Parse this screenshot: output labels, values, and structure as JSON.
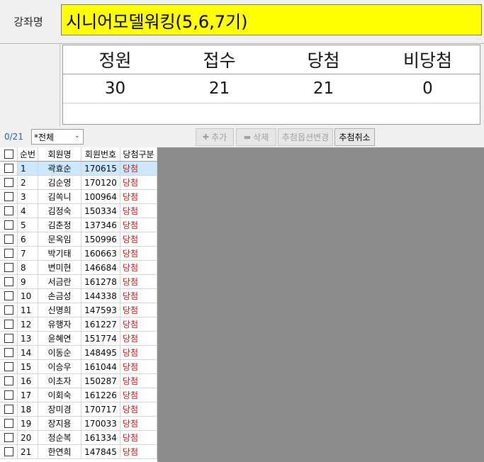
{
  "course": {
    "label": "강좌명",
    "name": "시니어모델워킹(5,6,7기)"
  },
  "stats": {
    "headers": [
      "정원",
      "접수",
      "당첨",
      "비당첨"
    ],
    "values": [
      "30",
      "21",
      "21",
      "0"
    ]
  },
  "toolbar": {
    "selected_count": "0/21",
    "filter_value": "*전체",
    "add_label": "추가",
    "delete_label": "삭제",
    "change_option_label": "추첨옵션변경",
    "cancel_draw_label": "추첨취소"
  },
  "grid": {
    "columns": [
      "순번",
      "회원명",
      "회원번호",
      "당첨구분"
    ],
    "rows": [
      {
        "no": "1",
        "name": "곽효순",
        "member_no": "170615",
        "status": "당첨"
      },
      {
        "no": "2",
        "name": "김순영",
        "member_no": "170120",
        "status": "당첨"
      },
      {
        "no": "3",
        "name": "김쏙니",
        "member_no": "100964",
        "status": "당첨"
      },
      {
        "no": "4",
        "name": "김정숙",
        "member_no": "150334",
        "status": "당첨"
      },
      {
        "no": "5",
        "name": "김춘정",
        "member_no": "137346",
        "status": "당첨"
      },
      {
        "no": "6",
        "name": "문옥임",
        "member_no": "150996",
        "status": "당첨"
      },
      {
        "no": "7",
        "name": "박기태",
        "member_no": "160663",
        "status": "당첨"
      },
      {
        "no": "8",
        "name": "변미현",
        "member_no": "146684",
        "status": "당첨"
      },
      {
        "no": "9",
        "name": "서금란",
        "member_no": "161278",
        "status": "당첨"
      },
      {
        "no": "10",
        "name": "손금성",
        "member_no": "144338",
        "status": "당첨"
      },
      {
        "no": "11",
        "name": "신명희",
        "member_no": "147593",
        "status": "당첨"
      },
      {
        "no": "12",
        "name": "유행자",
        "member_no": "161227",
        "status": "당첨"
      },
      {
        "no": "13",
        "name": "윤혜연",
        "member_no": "151774",
        "status": "당첨"
      },
      {
        "no": "14",
        "name": "이동순",
        "member_no": "148495",
        "status": "당첨"
      },
      {
        "no": "15",
        "name": "이승우",
        "member_no": "161044",
        "status": "당첨"
      },
      {
        "no": "16",
        "name": "이초자",
        "member_no": "150287",
        "status": "당첨"
      },
      {
        "no": "17",
        "name": "이회숙",
        "member_no": "161226",
        "status": "당첨"
      },
      {
        "no": "18",
        "name": "장미경",
        "member_no": "170717",
        "status": "당첨"
      },
      {
        "no": "19",
        "name": "장지용",
        "member_no": "170033",
        "status": "당첨"
      },
      {
        "no": "20",
        "name": "정순복",
        "member_no": "161334",
        "status": "당첨"
      },
      {
        "no": "21",
        "name": "한연희",
        "member_no": "147845",
        "status": "당첨"
      }
    ]
  },
  "colors": {
    "course_highlight": "#ffff00",
    "status_text": "#d01010",
    "selected_row": "#cce8ff",
    "count_text": "#2a5db0",
    "empty_area": "#8c8c8c"
  },
  "icons": [
    "add-icon",
    "delete-icon",
    "dropdown-arrow-icon",
    "checkbox-icon"
  ]
}
